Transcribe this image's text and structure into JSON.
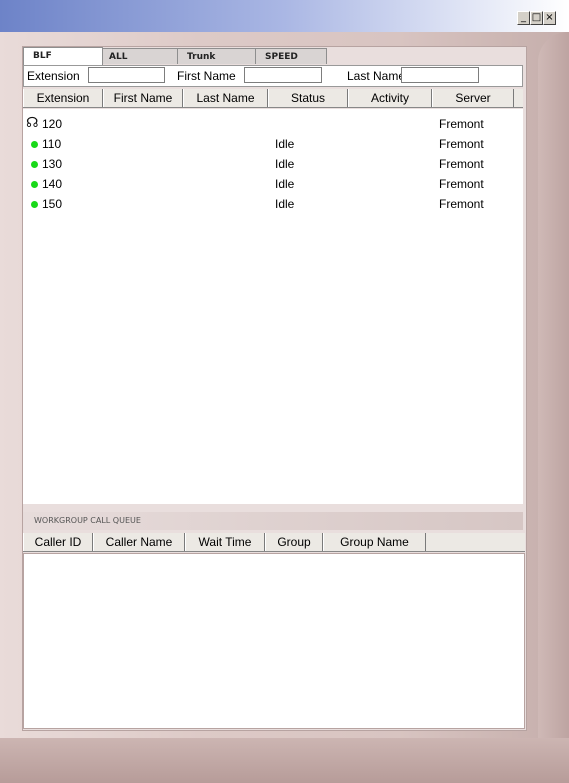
{
  "window": {
    "min_btn": "_",
    "max_btn": "□",
    "close_btn": "×"
  },
  "tabs": [
    {
      "label": "BLF",
      "active": true
    },
    {
      "label": "ALL",
      "active": false
    },
    {
      "label": "Trunk",
      "active": false
    },
    {
      "label": "SPEED",
      "active": false
    }
  ],
  "filter": {
    "extension_label": "Extension",
    "extension_value": "",
    "first_name_label": "First Name",
    "first_name_value": "",
    "last_name_label": "Last Name",
    "last_name_value": ""
  },
  "blf_table": {
    "columns": [
      "Extension",
      "First Name",
      "Last Name",
      "Status",
      "Activity",
      "Server"
    ],
    "rows": [
      {
        "icon": "headset-icon",
        "extension": "120",
        "first_name": "",
        "last_name": "",
        "status": "",
        "activity": "",
        "server": "Fremont"
      },
      {
        "icon": "green-status-icon",
        "extension": "110",
        "first_name": "",
        "last_name": "",
        "status": "Idle",
        "activity": "",
        "server": "Fremont"
      },
      {
        "icon": "green-status-icon",
        "extension": "130",
        "first_name": "",
        "last_name": "",
        "status": "Idle",
        "activity": "",
        "server": "Fremont"
      },
      {
        "icon": "green-status-icon",
        "extension": "140",
        "first_name": "",
        "last_name": "",
        "status": "Idle",
        "activity": "",
        "server": "Fremont"
      },
      {
        "icon": "green-status-icon",
        "extension": "150",
        "first_name": "",
        "last_name": "",
        "status": "Idle",
        "activity": "",
        "server": "Fremont"
      }
    ]
  },
  "queue": {
    "title": "WORKGROUP CALL QUEUE",
    "columns": [
      "Caller ID",
      "Caller Name",
      "Wait Time",
      "Group",
      "Group Name"
    ]
  },
  "colors": {
    "status_idle": "#18d918",
    "title_gradient_start": "#6d83c8"
  }
}
